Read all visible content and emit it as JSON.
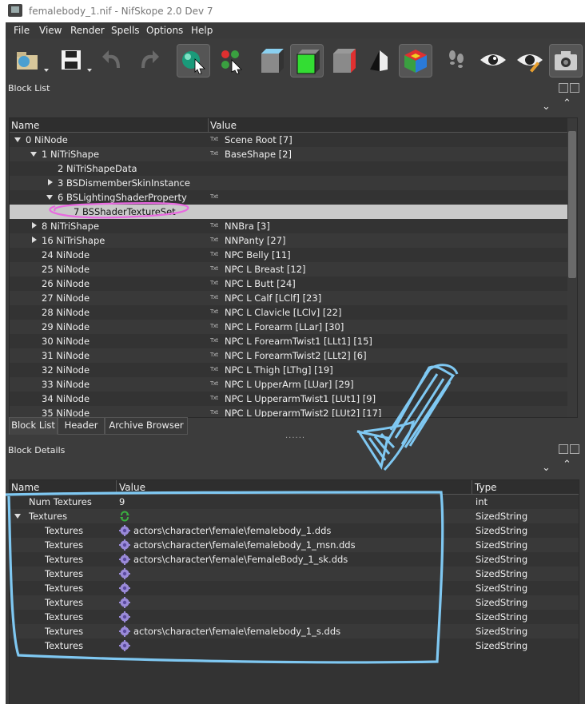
{
  "window": {
    "title": "femalebody_1.nif - NifSkope 2.0 Dev 7"
  },
  "menubar": {
    "items": [
      "File",
      "View",
      "Render",
      "Spells",
      "Options",
      "Help"
    ]
  },
  "toolbar": {
    "icons": [
      "load-icon",
      "save-icon",
      "undo-icon",
      "redo-icon",
      "select-sphere-icon",
      "node-graph-icon",
      "view-cube-front-icon",
      "view-cube-top-icon",
      "view-cube-side-icon",
      "view-flip-icon",
      "view-user-icon",
      "walk-icon",
      "eye-icon",
      "eye-pencil-icon",
      "screenshot-icon"
    ]
  },
  "block_list": {
    "title": "Block List",
    "columns": [
      "Name",
      "Value"
    ],
    "rows": [
      {
        "name": "0 NiNode",
        "value": "Scene Root [7]",
        "txt": true
      },
      {
        "name": "1 NiTriShape",
        "value": "BaseShape [2]",
        "txt": true
      },
      {
        "name": "2 NiTriShapeData",
        "value": "",
        "txt": false
      },
      {
        "name": "3 BSDismemberSkinInstance",
        "value": "",
        "txt": false
      },
      {
        "name": "6 BSLightingShaderProperty",
        "value": "",
        "txt": true
      },
      {
        "name": "7 BSShaderTextureSet",
        "value": "",
        "txt": false
      },
      {
        "name": "8 NiTriShape",
        "value": "NNBra [3]",
        "txt": true
      },
      {
        "name": "16 NiTriShape",
        "value": "NNPanty [27]",
        "txt": true
      },
      {
        "name": "24 NiNode",
        "value": "NPC Belly [11]",
        "txt": true
      },
      {
        "name": "25 NiNode",
        "value": "NPC L Breast [12]",
        "txt": true
      },
      {
        "name": "26 NiNode",
        "value": "NPC L Butt [24]",
        "txt": true
      },
      {
        "name": "27 NiNode",
        "value": "NPC L Calf [LClf] [23]",
        "txt": true
      },
      {
        "name": "28 NiNode",
        "value": "NPC L Clavicle [LClv] [22]",
        "txt": true
      },
      {
        "name": "29 NiNode",
        "value": "NPC L Forearm [LLar] [30]",
        "txt": true
      },
      {
        "name": "30 NiNode",
        "value": "NPC L ForearmTwist1 [LLt1] [15]",
        "txt": true
      },
      {
        "name": "31 NiNode",
        "value": "NPC L ForearmTwist2 [LLt2] [6]",
        "txt": true
      },
      {
        "name": "32 NiNode",
        "value": "NPC L Thigh [LThg] [19]",
        "txt": true
      },
      {
        "name": "33 NiNode",
        "value": "NPC L UpperArm [LUar] [29]",
        "txt": true
      },
      {
        "name": "34 NiNode",
        "value": "NPC L UpperarmTwist1 [LUt1] [9]",
        "txt": true
      },
      {
        "name": "35 NiNode",
        "value": "NPC L UpperarmTwist2 [LUt2] [17]",
        "txt": true
      }
    ],
    "tabs": [
      "Block List",
      "Header",
      "Archive Browser"
    ]
  },
  "block_details": {
    "title": "Block Details",
    "columns": [
      "Name",
      "Value",
      "Type"
    ],
    "rows": [
      {
        "name": "Num Textures",
        "value": "9",
        "type": "int",
        "icon": ""
      },
      {
        "name": "Textures",
        "value": "",
        "type": "SizedString",
        "icon": "refresh"
      },
      {
        "name": "Textures",
        "value": "actors\\character\\female\\femalebody_1.dds",
        "type": "SizedString",
        "icon": "gear"
      },
      {
        "name": "Textures",
        "value": "actors\\character\\female\\femalebody_1_msn.dds",
        "type": "SizedString",
        "icon": "gear"
      },
      {
        "name": "Textures",
        "value": "actors\\character\\female\\FemaleBody_1_sk.dds",
        "type": "SizedString",
        "icon": "gear"
      },
      {
        "name": "Textures",
        "value": "",
        "type": "SizedString",
        "icon": "gear"
      },
      {
        "name": "Textures",
        "value": "",
        "type": "SizedString",
        "icon": "gear"
      },
      {
        "name": "Textures",
        "value": "",
        "type": "SizedString",
        "icon": "gear"
      },
      {
        "name": "Textures",
        "value": "",
        "type": "SizedString",
        "icon": "gear"
      },
      {
        "name": "Textures",
        "value": "actors\\character\\female\\femalebody_1_s.dds",
        "type": "SizedString",
        "icon": "gear"
      },
      {
        "name": "Textures",
        "value": "",
        "type": "SizedString",
        "icon": "gear"
      }
    ]
  },
  "txt_label": "Txt",
  "splitter_grip": "......",
  "colors": {
    "annotation_blue": "#7fc8f2",
    "annotation_pink": "#e86ae0"
  }
}
